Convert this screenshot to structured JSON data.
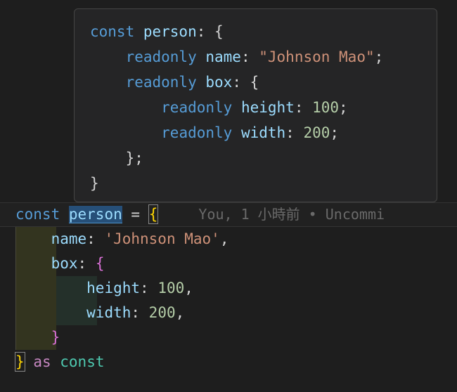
{
  "editor": {
    "background_color": "#1e1e1e",
    "font_size_px": 21,
    "current_line": {
      "blame_annotation": "You, 1 小時前 • Uncommi",
      "tokens": {
        "const": "const",
        "space1": " ",
        "identifier": "person",
        "space2": " ",
        "equals": "=",
        "space3": " ",
        "open_brace": "{"
      }
    },
    "lines": [
      {
        "indent": "    ",
        "property": "name",
        "colon": ": ",
        "value": "'Johnson Mao'",
        "trailing": ",",
        "kind": "string"
      },
      {
        "indent": "    ",
        "property": "box",
        "colon": ": ",
        "value": "{",
        "trailing": "",
        "kind": "brace"
      },
      {
        "indent": "        ",
        "property": "height",
        "colon": ": ",
        "value": "100",
        "trailing": ",",
        "kind": "number"
      },
      {
        "indent": "        ",
        "property": "width",
        "colon": ": ",
        "value": "200",
        "trailing": ",",
        "kind": "number"
      },
      {
        "indent": "    ",
        "property": "",
        "colon": "",
        "value": "}",
        "trailing": "",
        "kind": "brace"
      }
    ],
    "closing_line": {
      "close_brace": "}",
      "space": " ",
      "as_keyword": "as",
      "space2": " ",
      "const_keyword": "const"
    }
  },
  "tooltip": {
    "name": "type-hover-tooltip",
    "background_color": "#252526",
    "border_color": "#454545",
    "lines": [
      {
        "segments": [
          {
            "text": "const ",
            "color_role": "keyword"
          },
          {
            "text": "person",
            "color_role": "variable"
          },
          {
            "text": ": {",
            "color_role": "punct"
          }
        ]
      },
      {
        "segments": [
          {
            "text": "    ",
            "color_role": "punct"
          },
          {
            "text": "readonly ",
            "color_role": "keyword"
          },
          {
            "text": "name",
            "color_role": "property"
          },
          {
            "text": ": ",
            "color_role": "punct"
          },
          {
            "text": "\"Johnson Mao\"",
            "color_role": "string"
          },
          {
            "text": ";",
            "color_role": "punct"
          }
        ]
      },
      {
        "segments": [
          {
            "text": "    ",
            "color_role": "punct"
          },
          {
            "text": "readonly ",
            "color_role": "keyword"
          },
          {
            "text": "box",
            "color_role": "property"
          },
          {
            "text": ": {",
            "color_role": "punct"
          }
        ]
      },
      {
        "segments": [
          {
            "text": "        ",
            "color_role": "punct"
          },
          {
            "text": "readonly ",
            "color_role": "keyword"
          },
          {
            "text": "height",
            "color_role": "property"
          },
          {
            "text": ": ",
            "color_role": "punct"
          },
          {
            "text": "100",
            "color_role": "number"
          },
          {
            "text": ";",
            "color_role": "punct"
          }
        ]
      },
      {
        "segments": [
          {
            "text": "        ",
            "color_role": "punct"
          },
          {
            "text": "readonly ",
            "color_role": "keyword"
          },
          {
            "text": "width",
            "color_role": "property"
          },
          {
            "text": ": ",
            "color_role": "punct"
          },
          {
            "text": "200",
            "color_role": "number"
          },
          {
            "text": ";",
            "color_role": "punct"
          }
        ]
      },
      {
        "segments": [
          {
            "text": "    };",
            "color_role": "punct"
          }
        ]
      },
      {
        "segments": [
          {
            "text": "}",
            "color_role": "punct"
          }
        ]
      }
    ]
  },
  "colors": {
    "keyword": "#569cd6",
    "variable": "#9cdcfe",
    "property": "#9cdcfe",
    "string": "#ce9178",
    "number": "#b5cea8",
    "punct": "#d4d4d4",
    "brace_pink": "#da70d6",
    "control": "#c586c0",
    "type": "#4ec9b0",
    "blame": "#6a6a6a",
    "bracket_match": "#ffd602",
    "occurrence_bg": "#264f78",
    "indent_outer": "#33341f",
    "indent_inner": "#24302a"
  }
}
